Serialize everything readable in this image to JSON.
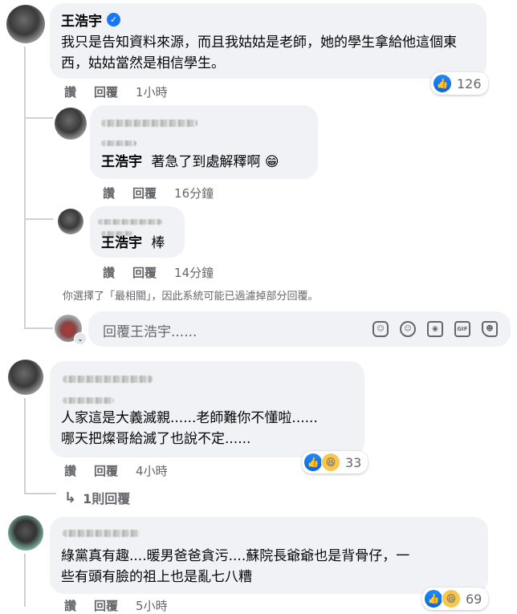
{
  "comment1": {
    "author": "王浩宇",
    "text": "我只是告知資料來源，而且我姑姑是老師，她的學生拿給他這個東西，姑姑當然是相信學生。",
    "like_label": "讚",
    "reply_label": "回覆",
    "time": "1小時",
    "reaction_count": "126"
  },
  "reply1": {
    "mention": "王浩宇",
    "text": "著急了到處解釋啊",
    "emoji": "😁",
    "like_label": "讚",
    "reply_label": "回覆",
    "time": "16分鐘"
  },
  "reply2": {
    "mention": "王浩宇",
    "text": "棒",
    "like_label": "讚",
    "reply_label": "回覆",
    "time": "14分鐘"
  },
  "filter_notice": "你選擇了「最相關」，因此系統可能已過濾掉部分回覆。",
  "composer": {
    "placeholder": "回覆王浩宇......",
    "icons": [
      "sticker-icon",
      "emoji-icon",
      "camera-icon",
      "gif-icon",
      "sticker2-icon"
    ]
  },
  "comment2": {
    "line1": "人家這是大義滅親......老師難你不懂啦......",
    "line2": "哪天把燦哥給滅了也說不定......",
    "like_label": "讚",
    "reply_label": "回覆",
    "time": "4小時",
    "reaction_count": "33",
    "replies_link": "1則回覆"
  },
  "comment3": {
    "line1": "綠黨真有趣....暖男爸爸貪污....蘇院長爺爺也是背骨仔，一",
    "line2": "些有頭有臉的祖上也是亂七八糟",
    "like_label": "讚",
    "reply_label": "回覆",
    "time": "5小時",
    "reaction_count": "69"
  },
  "colors": {
    "bubble": "#f0f2f5",
    "meta": "#65676b",
    "like_blue": "#1877f2",
    "verified": "#1877f2"
  }
}
